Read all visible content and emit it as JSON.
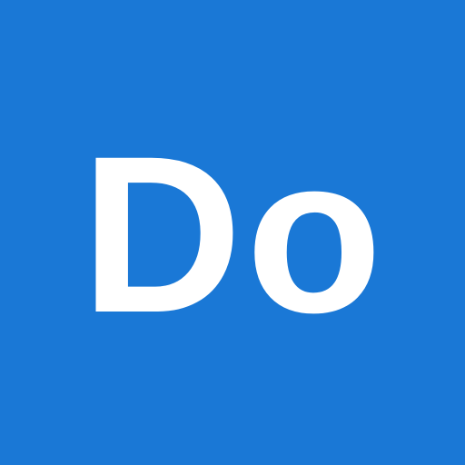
{
  "tile": {
    "text": "Do",
    "background_color": "#1a78d6",
    "text_color": "#ffffff"
  }
}
